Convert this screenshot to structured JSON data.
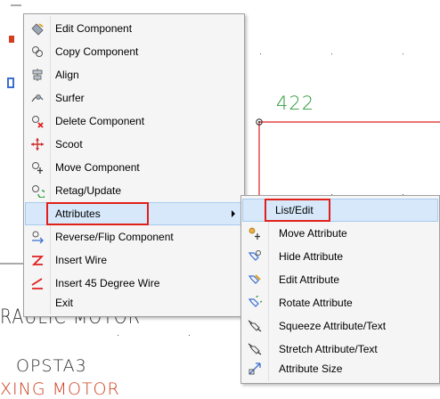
{
  "canvas": {
    "number_label": "422",
    "text_motor_1": "RAULIC MOTOR",
    "text_opsta": "OPSTA3",
    "text_motor_2": "XING MOTOR",
    "colors": {
      "green": "#2e9d3a",
      "red_wire": "#e02020",
      "dark_text": "#333333",
      "orange_text": "#d04020",
      "blue_mark": "#3a6fd1"
    }
  },
  "context_menu": {
    "items": [
      {
        "label": "Edit Component",
        "icon": "edit-component-icon"
      },
      {
        "label": "Copy Component",
        "icon": "copy-component-icon"
      },
      {
        "label": "Align",
        "icon": "align-icon"
      },
      {
        "label": "Surfer",
        "icon": "surfer-icon"
      },
      {
        "label": "Delete Component",
        "icon": "delete-component-icon"
      },
      {
        "label": "Scoot",
        "icon": "scoot-icon"
      },
      {
        "label": "Move Component",
        "icon": "move-component-icon"
      },
      {
        "label": "Retag/Update",
        "icon": "retag-update-icon"
      },
      {
        "label": "Attributes",
        "icon": "",
        "has_submenu": true,
        "highlighted": true
      },
      {
        "label": "Reverse/Flip Component",
        "icon": "reverse-flip-icon"
      },
      {
        "label": "Insert Wire",
        "icon": "insert-wire-icon"
      },
      {
        "label": "Insert 45 Degree Wire",
        "icon": "insert-45-wire-icon"
      },
      {
        "label": "Exit",
        "icon": ""
      }
    ]
  },
  "submenu": {
    "items": [
      {
        "label": "List/Edit",
        "icon": "",
        "highlighted": true
      },
      {
        "label": "Move Attribute",
        "icon": "move-attribute-icon"
      },
      {
        "label": "Hide Attribute",
        "icon": "hide-attribute-icon"
      },
      {
        "label": "Edit Attribute",
        "icon": "edit-attribute-icon"
      },
      {
        "label": "Rotate Attribute",
        "icon": "rotate-attribute-icon"
      },
      {
        "label": "Squeeze Attribute/Text",
        "icon": "squeeze-attribute-icon"
      },
      {
        "label": "Stretch Attribute/Text",
        "icon": "stretch-attribute-icon"
      },
      {
        "label": "Attribute Size",
        "icon": "attribute-size-icon"
      }
    ]
  },
  "highlight_box_color": "#e0201a"
}
